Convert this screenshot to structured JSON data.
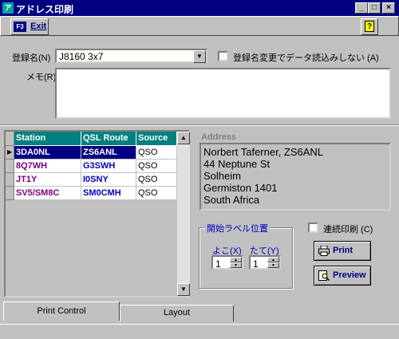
{
  "window": {
    "title": "アドレス印刷",
    "app_icon": "app-icon",
    "controls": [
      "_",
      "□",
      "×"
    ]
  },
  "toolbar": {
    "exit_icon_text": "F3",
    "exit_label": "Exit",
    "help_icon_text": "?"
  },
  "form": {
    "name_label": "登録名(N)",
    "name_value": "J8160 3x7",
    "no_reload_label": "登録名変更でデータ読込みしない (A)",
    "memo_label": "メモ(R)",
    "memo_value": ""
  },
  "grid": {
    "columns": [
      "Station",
      "QSL Route",
      "Source"
    ],
    "rows": [
      {
        "station": "3DA0NL",
        "route": "ZS6ANL",
        "source": "QSO",
        "selected": true
      },
      {
        "station": "8Q7WH",
        "route": "G3SWH",
        "source": "QSO",
        "selected": false
      },
      {
        "station": "JT1Y",
        "route": "I0SNY",
        "source": "QSO",
        "selected": false
      },
      {
        "station": "SV5/SM8C",
        "route": "SM0CMH",
        "source": "QSO",
        "selected": false
      }
    ],
    "colors": {
      "header": "#008080",
      "station": "#800080",
      "route": "#0000c0",
      "selected": "#000080"
    }
  },
  "address": {
    "label": "Address",
    "lines": [
      "Norbert Taferner, ZS6ANL",
      "44 Neptune St",
      "Solheim",
      "Germiston 1401",
      "South Africa"
    ]
  },
  "label_position": {
    "title": "開始ラベル位置",
    "horizontal_label": "よこ(X)",
    "horizontal_value": "1",
    "vertical_label": "たて(Y)",
    "vertical_value": "1"
  },
  "continuous_print_label": "連続印刷 (C)",
  "print_button": "Print",
  "preview_button": "Preview",
  "tabs": [
    {
      "label": "Print Control",
      "active": true
    },
    {
      "label": "Layout",
      "active": false
    }
  ]
}
